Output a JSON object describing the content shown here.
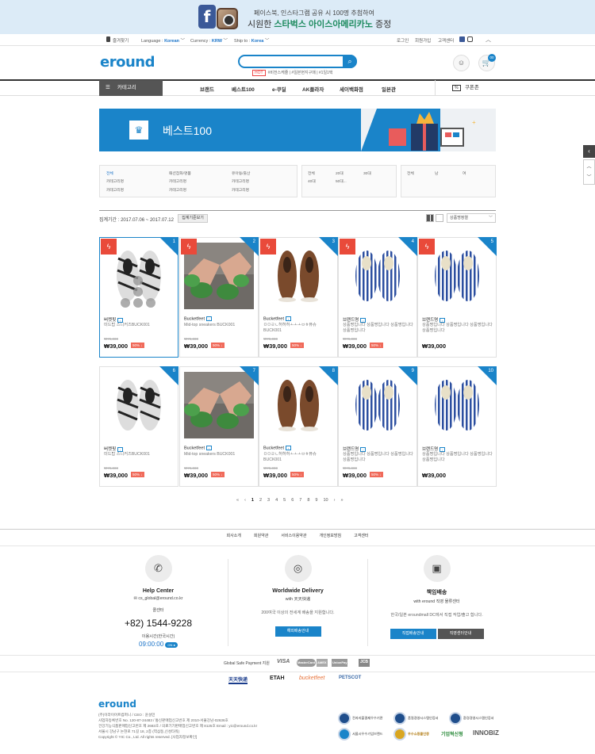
{
  "banner": {
    "line1": "페이스북, 인스타그램 공유 시 100명 추첨하여",
    "line2a": "시원한 ",
    "line2b": "스타벅스 아이스아메리카노",
    "line2c": " 증정",
    "fb_glyph": "f"
  },
  "util": {
    "bookmark": "즐겨찾기",
    "language_label": "Language :",
    "language_value": "Korean",
    "currency_label": "Currency :",
    "currency_value": "KRW",
    "ship_label": "Ship to :",
    "ship_value": "Korea",
    "login": "로그인",
    "join": "회원가입",
    "support": "고객센터",
    "up": "︿"
  },
  "header": {
    "logo": "eround",
    "search_placeholder": "",
    "search_glyph": "⌕",
    "tag_hot": "HOT",
    "tags": "#비전스케줄  | #일본현지구매  | #1일1택",
    "user_glyph": "☺",
    "cart_glyph": "🛒",
    "cart_count": "00"
  },
  "nav": {
    "category": "카테고리",
    "menu_glyph": "☰",
    "items": [
      "브랜드",
      "베스트100",
      "e-쿠딜",
      "AK플라자",
      "세이백화점",
      "일본관"
    ],
    "coupon_badge": "%",
    "coupon": "쿠폰존"
  },
  "hero": {
    "title": "베스트100",
    "crown": "♛"
  },
  "filters": {
    "col1": [
      "전체",
      "카테고리명",
      "카테고리명"
    ],
    "col2": [
      "패션잡화/명품",
      "카테고리명",
      "카테고리명"
    ],
    "col3": [
      "유아동/출산",
      "카테고리명",
      "카테고리명"
    ],
    "ages": [
      "전체",
      "20대",
      "30대",
      "40대",
      "50대..."
    ],
    "gender": [
      "전체",
      "남",
      "여"
    ]
  },
  "period": {
    "text": "집계기간 : 2017.07.06 ~ 2017.07.12",
    "button": "집계기준보기",
    "sort": "상품명정렬"
  },
  "products": [
    {
      "rank": "1",
      "brand": "버켓핏",
      "name": "미드탑 스니커즈BUCK001",
      "orig": "₩79,000",
      "price": "₩39,000",
      "disc": "50% ↓",
      "flash": true,
      "type": "zebra"
    },
    {
      "rank": "2",
      "brand": "Bucketfeet",
      "name": "Mid-top sneakers BUCK001",
      "orig": "₩79,000",
      "price": "₩39,000",
      "disc": "50% ↓",
      "flash": true,
      "type": "feet"
    },
    {
      "rank": "3",
      "brand": "Bucketfeet",
      "name": "ㅁㅁㄹㄴ허허허ㅗㅗㅗㅂㅎ퓨슈 BUCK001",
      "orig": "₩79,000",
      "price": "₩39,000",
      "disc": "50% ↓",
      "flash": true,
      "type": "brown"
    },
    {
      "rank": "4",
      "brand": "브랜드명",
      "name": "상품명입니다 상품명입니다 상품명입니다 상품명입니다",
      "orig": "₩79,000",
      "price": "₩39,000",
      "disc": "50% ↓",
      "flash": true,
      "type": "stripe"
    },
    {
      "rank": "5",
      "brand": "브랜드명",
      "name": "상품명입니다 상품명입니다 상품명입니다 상품명입니다",
      "orig": "",
      "price": "₩39,000",
      "disc": "",
      "flash": true,
      "type": "stripe"
    },
    {
      "rank": "6",
      "brand": "버켓핏",
      "name": "미드탑 스니커즈BUCK001",
      "orig": "₩79,000",
      "price": "₩39,000",
      "disc": "50% ↓",
      "flash": false,
      "type": "zebra"
    },
    {
      "rank": "7",
      "brand": "Bucketfeet",
      "name": "Mid-top sneakers BUCK001",
      "orig": "₩79,000",
      "price": "₩39,000",
      "disc": "50% ↓",
      "flash": false,
      "type": "feet"
    },
    {
      "rank": "8",
      "brand": "Bucketfeet",
      "name": "ㅁㅁㄹㄴ허허허ㅗㅗㅗㅂㅎ퓨슈 BUCK001",
      "orig": "₩79,000",
      "price": "₩39,000",
      "disc": "50% ↓",
      "flash": false,
      "type": "brown"
    },
    {
      "rank": "9",
      "brand": "브랜드명",
      "name": "상품명입니다 상품명입니다 상품명입니다 상품명입니다",
      "orig": "₩79,000",
      "price": "₩39,000",
      "disc": "50% ↓",
      "flash": false,
      "type": "stripe"
    },
    {
      "rank": "10",
      "brand": "브랜드명",
      "name": "상품명입니다 상품명입니다 상품명입니다 상품명입니다",
      "orig": "",
      "price": "₩39,000",
      "disc": "",
      "flash": false,
      "type": "stripe"
    }
  ],
  "pager": [
    "«",
    "‹",
    "1",
    "2",
    "3",
    "4",
    "5",
    "6",
    "7",
    "8",
    "9",
    "10",
    "›",
    "»"
  ],
  "footer_links": [
    "회사소개",
    "회원약관",
    "서비스이용약관",
    "개인정보방침",
    "고객센터"
  ],
  "help": {
    "title": "Help Center",
    "email": "✉ cs_global@eround.co.kr",
    "tel_label": "콜센터",
    "phone": "+82) 1544-9228",
    "hours_label": "이용시간(한국시간)",
    "hours": "09:00:00",
    "on": "ON ●",
    "icon": "✆"
  },
  "delivery": {
    "title": "Worldwide Delivery",
    "sub": "with 天天快递",
    "desc": "200여국 이상의 전세계 배송을 지원합니다.",
    "button": "해외배송안내",
    "icon": "◎"
  },
  "backpack": {
    "title": "책임배송",
    "sub": "with eround 직영 물류센터",
    "desc": "한국/일본 eroundmall DC에서 직접 작업/출고 합니다.",
    "button1": "직접배송안내",
    "button2": "직영센터안내",
    "icon": "▣"
  },
  "payment": {
    "label": "Global Safe Payment 지원",
    "logos": [
      "VISA",
      "MasterCard",
      "AMEX",
      "UnionPay",
      "JCB"
    ]
  },
  "partners": [
    "天天快递",
    "ETAH",
    "bucketfeet",
    "PETSCOT"
  ],
  "footer": {
    "logo": "eround",
    "lines": [
      "(주)이라이어트컴퍼니 / CEO : 윤설민",
      "사업자등록번호 No. 120-87-24483 / 통신판매업신고번호 제 2010-서울강남-02636호",
      "건강기능식품판매업신고번호 제 2683호 / 의료기기판매업신고번호 제 8125호 Email : yic@eround.co.kr",
      "서울시 강남구 논현로 71길 18, 2층 (역삼동,신성타워)",
      "Copyright © YIC Co., Ltd. All rights reserved. [사업자정보확인]"
    ]
  },
  "certs": [
    "전자지불결제우수기관",
    "품질경영시스템인증서",
    "환경경영시스템인증서",
    "서울시우수기업브랜드",
    "우수쇼핑몰인증",
    "기업혁신형",
    "INNOBIZ"
  ],
  "side": {
    "prev": "‹",
    "up": "︿",
    "down": "﹀"
  }
}
